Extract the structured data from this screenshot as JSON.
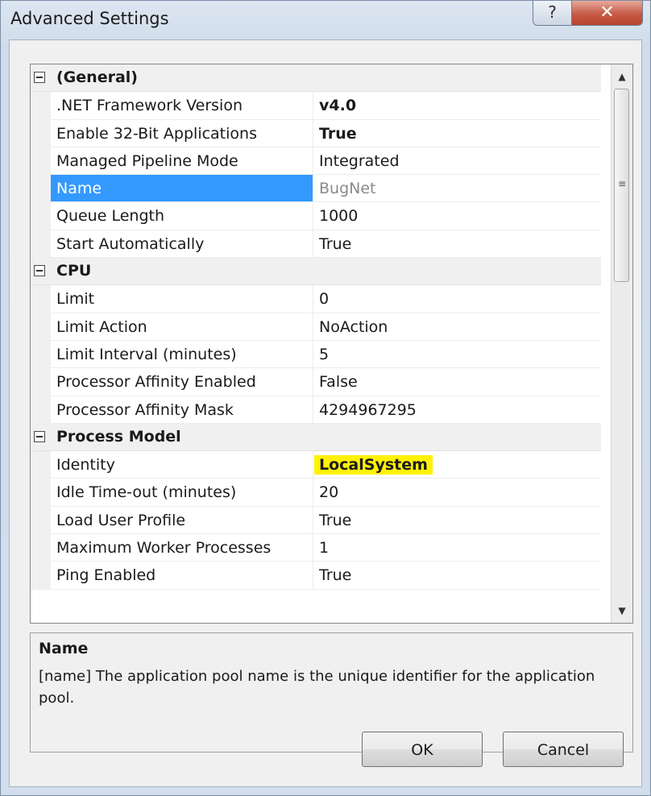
{
  "window": {
    "title": "Advanced Settings",
    "help_glyph": "?",
    "close_glyph": "✕"
  },
  "grid": {
    "categories": [
      {
        "label": "(General)",
        "properties": [
          {
            "name": ".NET Framework Version",
            "value": "v4.0",
            "style": "bold"
          },
          {
            "name": "Enable 32-Bit Applications",
            "value": "True",
            "style": "bold"
          },
          {
            "name": "Managed Pipeline Mode",
            "value": "Integrated",
            "style": "normal"
          },
          {
            "name": "Name",
            "value": "BugNet",
            "style": "muted",
            "selected": true
          },
          {
            "name": "Queue Length",
            "value": "1000",
            "style": "normal"
          },
          {
            "name": "Start Automatically",
            "value": "True",
            "style": "normal"
          }
        ]
      },
      {
        "label": "CPU",
        "properties": [
          {
            "name": "Limit",
            "value": "0",
            "style": "normal"
          },
          {
            "name": "Limit Action",
            "value": "NoAction",
            "style": "normal"
          },
          {
            "name": "Limit Interval (minutes)",
            "value": "5",
            "style": "normal"
          },
          {
            "name": "Processor Affinity Enabled",
            "value": "False",
            "style": "normal"
          },
          {
            "name": "Processor Affinity Mask",
            "value": "4294967295",
            "style": "normal"
          }
        ]
      },
      {
        "label": "Process Model",
        "properties": [
          {
            "name": "Identity",
            "value": "LocalSystem",
            "style": "highlight"
          },
          {
            "name": "Idle Time-out (minutes)",
            "value": "20",
            "style": "normal"
          },
          {
            "name": "Load User Profile",
            "value": "True",
            "style": "normal"
          },
          {
            "name": "Maximum Worker Processes",
            "value": "1",
            "style": "normal"
          },
          {
            "name": "Ping Enabled",
            "value": "True",
            "style": "normal"
          }
        ]
      }
    ],
    "highlight_color": "#fff200",
    "selection_color": "#3399ff",
    "scroll_position": 0.0
  },
  "description": {
    "title": "Name",
    "text": "[name] The application pool name is the unique identifier for the application pool."
  },
  "buttons": {
    "ok_label": "OK",
    "cancel_label": "Cancel"
  }
}
